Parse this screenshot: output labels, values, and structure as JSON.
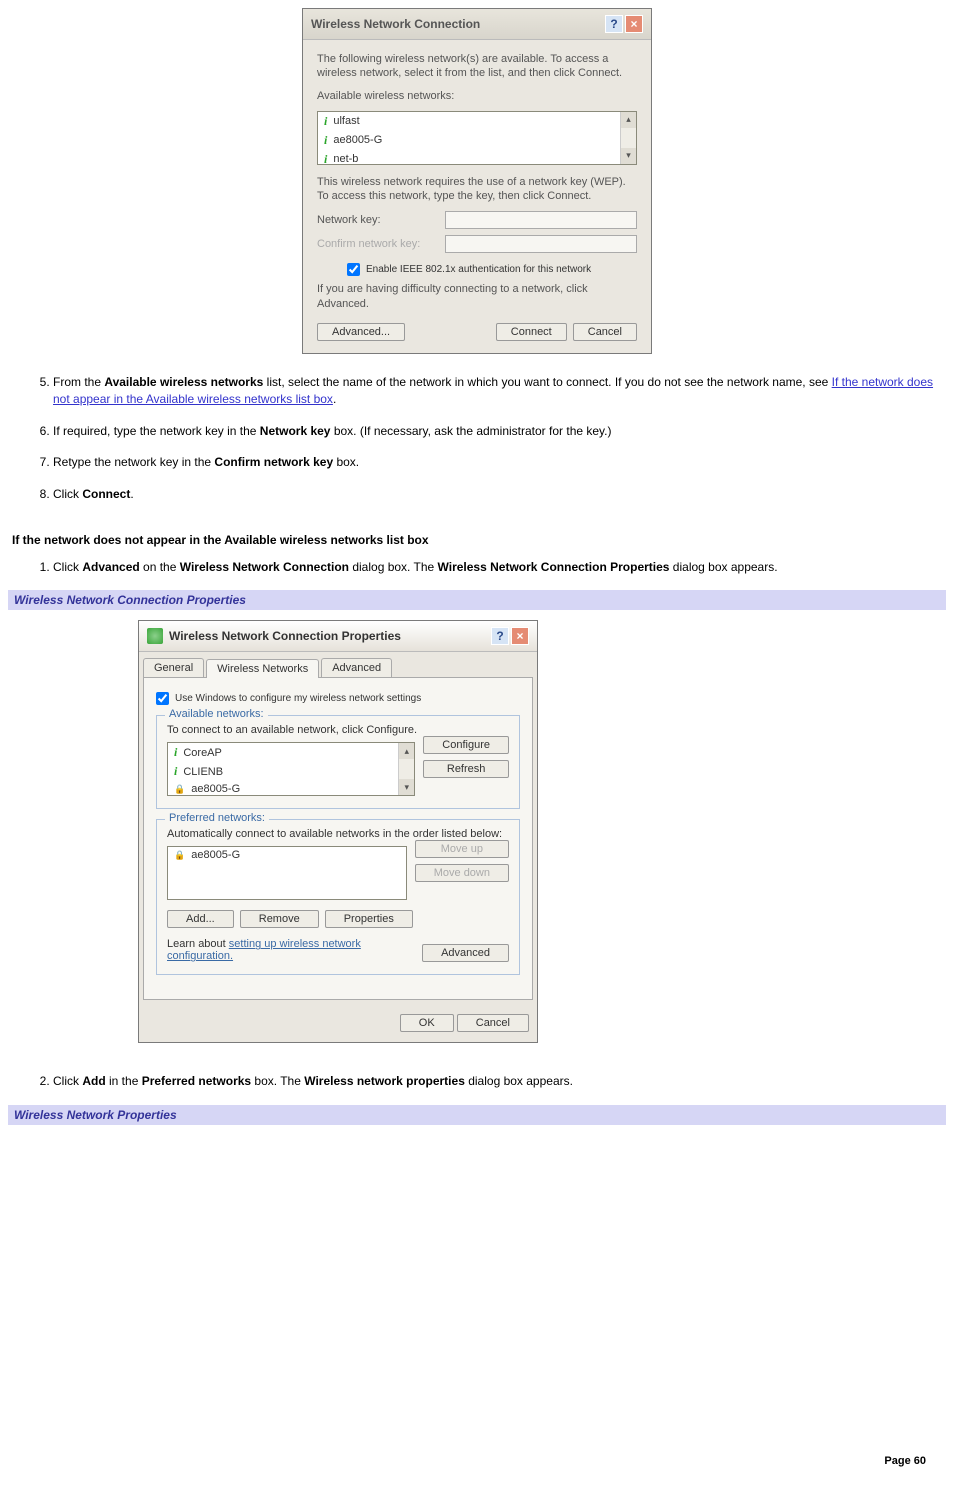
{
  "dlg1": {
    "title": "Wireless Network Connection",
    "intro": "The following wireless network(s) are available. To access a wireless network, select it from the list, and then click Connect.",
    "availLabel": "Available wireless networks:",
    "items": [
      "ulfast",
      "ae8005-G",
      "net-b"
    ],
    "wepText": "This wireless network requires the use of a network key (WEP). To access this network, type the key, then click Connect.",
    "netKeyLabel": "Network key:",
    "confirmKeyLabel": "Confirm network key:",
    "ieeeLabel": "Enable IEEE 802.1x authentication for this network",
    "advText": "If you are having difficulty connecting to a network, click Advanced.",
    "advancedBtn": "Advanced...",
    "connectBtn": "Connect",
    "cancelBtn": "Cancel"
  },
  "step5a": "From the ",
  "step5b": "Available wireless networks",
  "step5c": " list, select the name of the network in which you want to connect. If you do not see the network name, see ",
  "step5link": "If the network does not appear in the Available wireless networks list box",
  "step6a": "If required, type the network key in the ",
  "step6b": "Network key",
  "step6c": " box. (If necessary, ask the administrator for the key.)",
  "step7a": "Retype the network key in the ",
  "step7b": "Confirm network key",
  "step7c": " box.",
  "step8a": "Click ",
  "step8b": "Connect",
  "subHeading": "If the network does not appear in the Available wireless networks list box",
  "step1a": "Click ",
  "step1b": "Advanced",
  "step1c": " on the ",
  "step1d": "Wireless Network Connection",
  "step1e": " dialog box. The ",
  "step1f": "Wireless Network Connection Properties",
  "step1g": " dialog box appears.",
  "caption1": "Wireless Network Connection Properties",
  "dlg2": {
    "title": "Wireless Network Connection Properties",
    "tabGeneral": "General",
    "tabWireless": "Wireless Networks",
    "tabAdvanced": "Advanced",
    "useWindows": "Use Windows to configure my wireless network settings",
    "availLegend": "Available networks:",
    "availText": "To connect to an available network, click Configure.",
    "availItems": [
      "CoreAP",
      "CLIENB",
      "ae8005-G"
    ],
    "configureBtn": "Configure",
    "refreshBtn": "Refresh",
    "prefLegend": "Preferred networks:",
    "prefText": "Automatically connect to available networks in the order listed below:",
    "prefItems": [
      "ae8005-G"
    ],
    "moveUp": "Move up",
    "moveDown": "Move down",
    "addBtn": "Add...",
    "removeBtn": "Remove",
    "propertiesBtn": "Properties",
    "learnA": "Learn about ",
    "learnB": "setting up wireless network configuration.",
    "advancedBtn": "Advanced",
    "okBtn": "OK",
    "cancelBtn": "Cancel"
  },
  "step2a": "Click ",
  "step2b": "Add",
  "step2c": " in the ",
  "step2d": "Preferred networks",
  "step2e": " box. The ",
  "step2f": "Wireless network properties",
  "step2g": " dialog box appears.",
  "caption2": "Wireless Network Properties",
  "pageNum": "Page 60"
}
